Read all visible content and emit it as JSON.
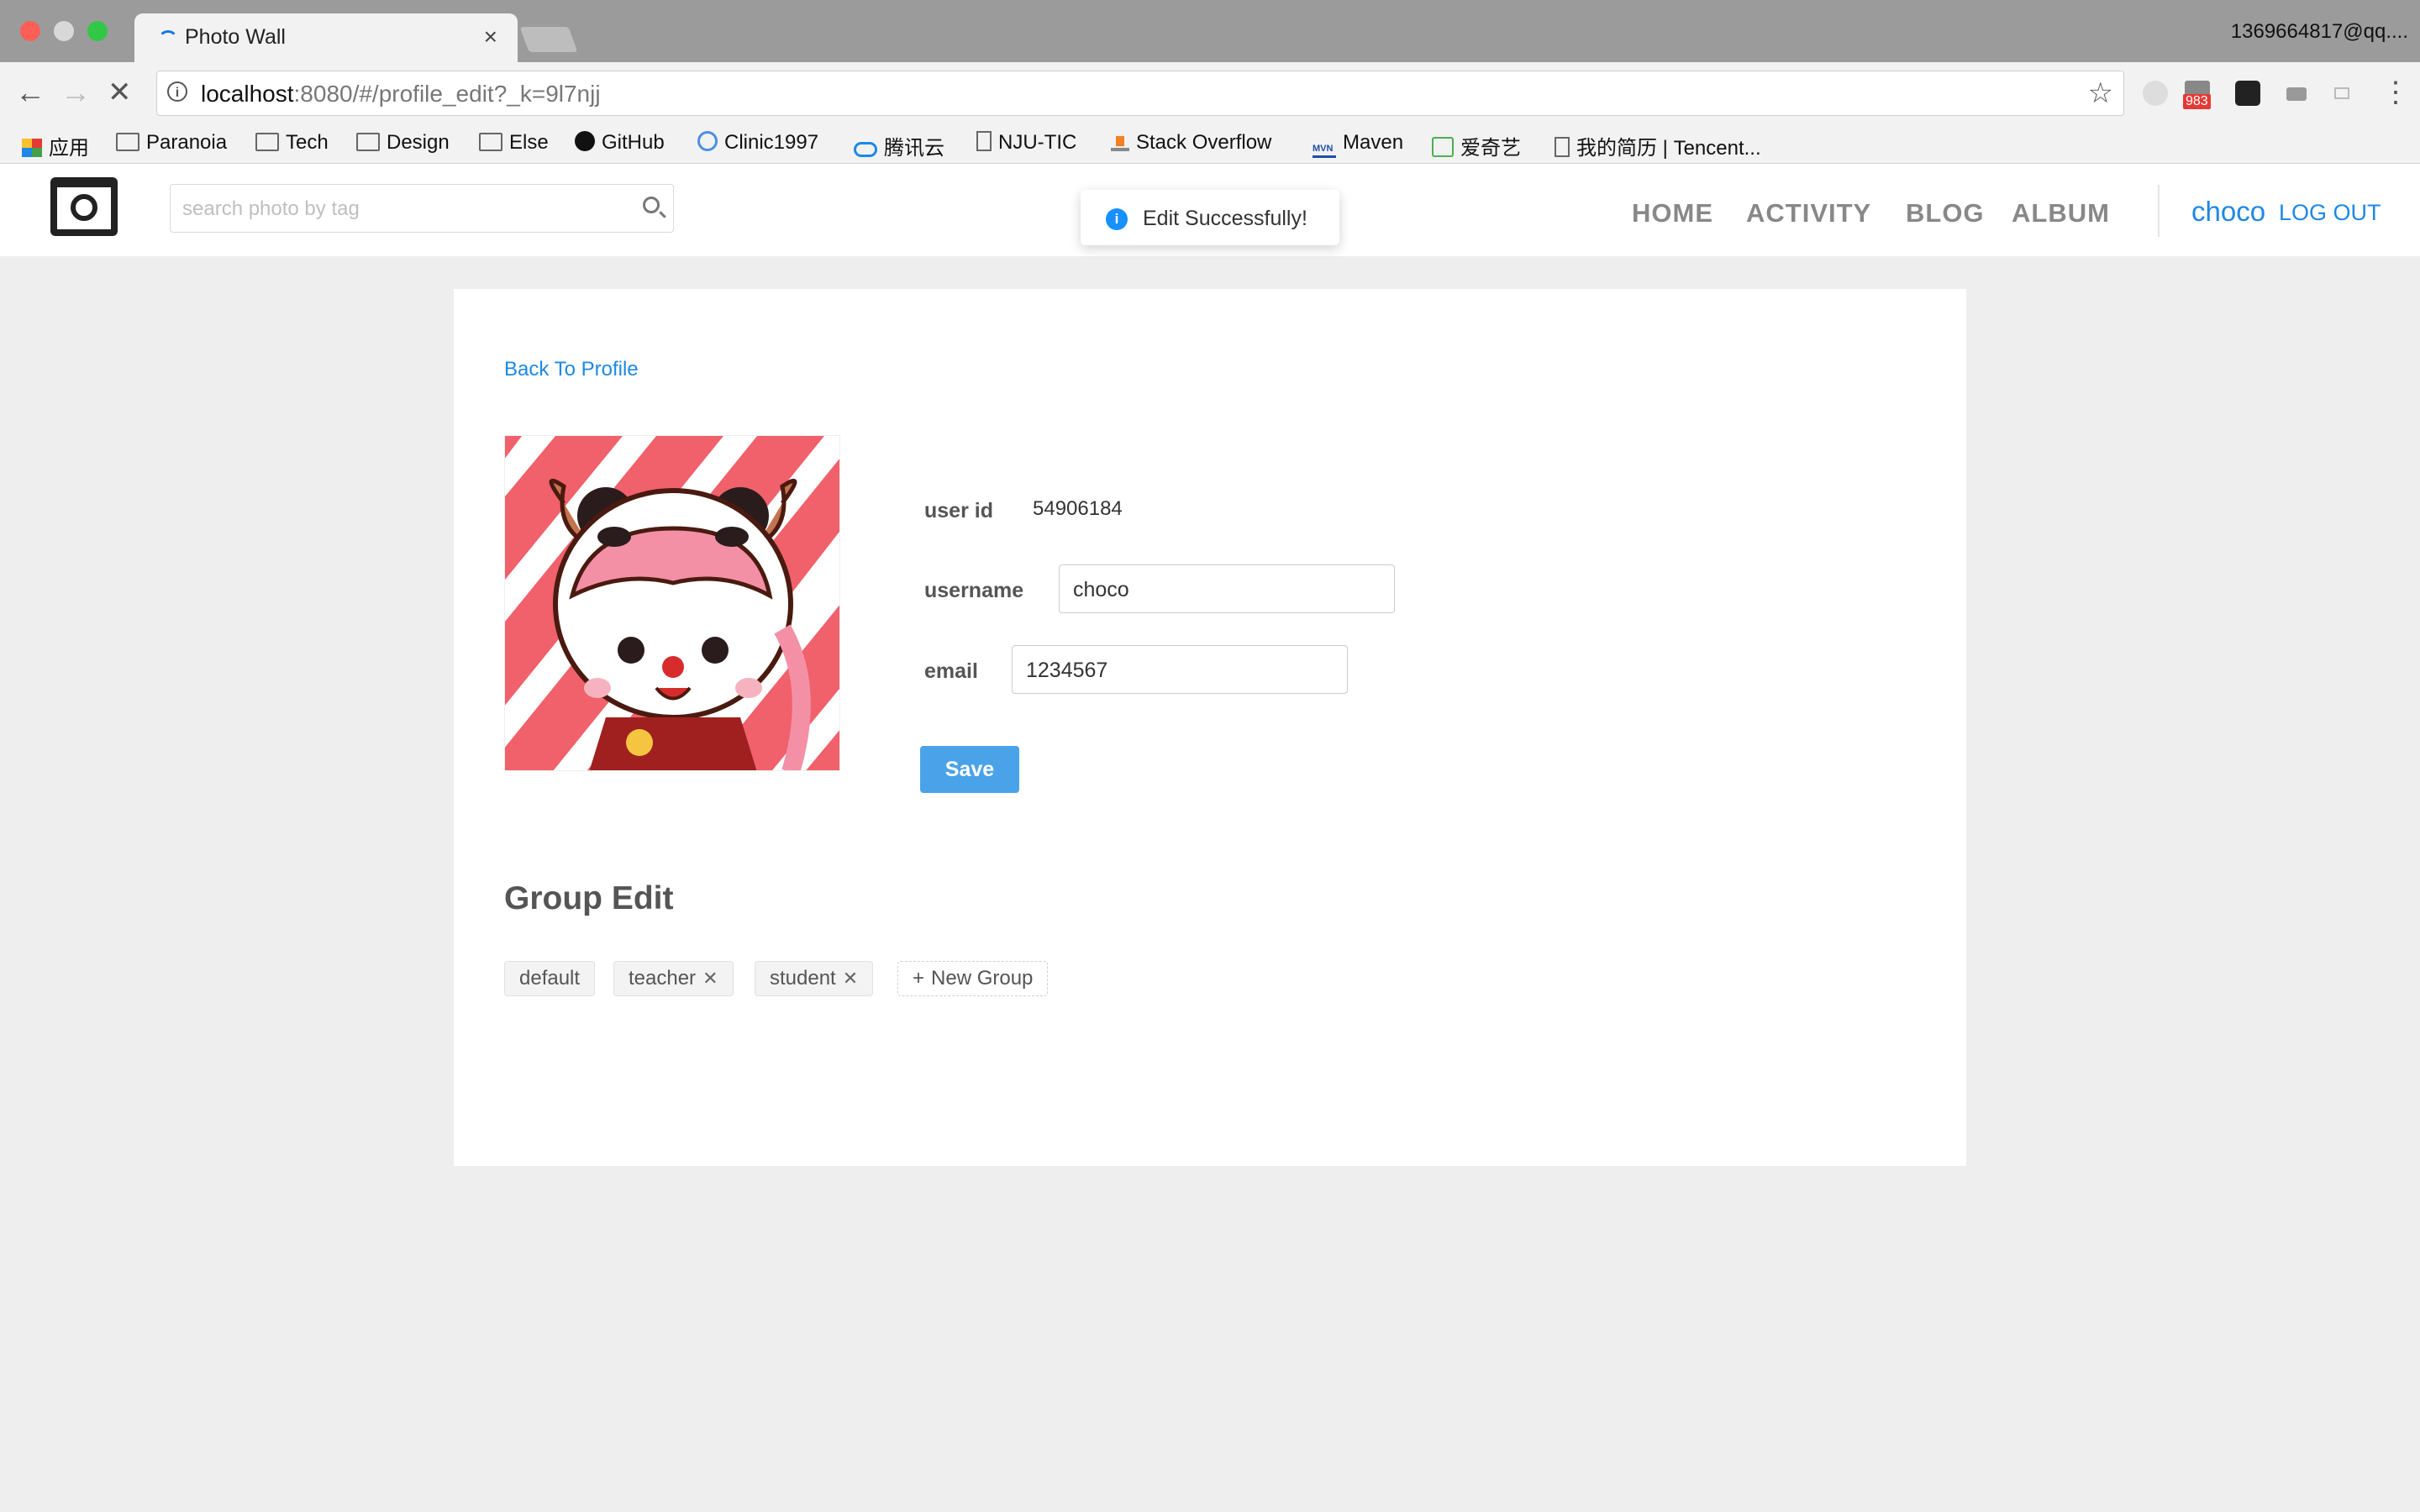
{
  "browser": {
    "tab_title": "Photo Wall",
    "tab_close": "×",
    "profile_email": "1369664817@qq....",
    "url_host": "localhost",
    "url_rest": ":8080/#/profile_edit?_k=9l7njj",
    "ext_badge": "983",
    "bookmarks": [
      "应用",
      "Paranoia",
      "Tech",
      "Design",
      "Else",
      "GitHub",
      "Clinic1997",
      "腾讯云",
      "NJU-TIC",
      "Stack Overflow",
      "Maven",
      "爱奇艺",
      "我的简历 | Tencent..."
    ]
  },
  "header": {
    "search_placeholder": "search photo by tag",
    "nav": [
      "HOME",
      "ACTIVITY",
      "BLOG",
      "ALBUM"
    ],
    "username": "choco",
    "logout": "LOG OUT"
  },
  "toast": {
    "icon": "i",
    "message": "Edit Successfully!"
  },
  "profile": {
    "back_link": "Back To Profile",
    "user_id_label": "user id",
    "user_id": "54906184",
    "username_label": "username",
    "username_value": "choco",
    "email_label": "email",
    "email_value": "1234567",
    "save_label": "Save"
  },
  "groups": {
    "title": "Group Edit",
    "tags": [
      "default",
      "teacher",
      "student"
    ],
    "new_group": "New Group"
  },
  "colors": {
    "accent": "#1e88e5",
    "save_button": "#4aa3e8",
    "toast_info": "#1890ff"
  }
}
